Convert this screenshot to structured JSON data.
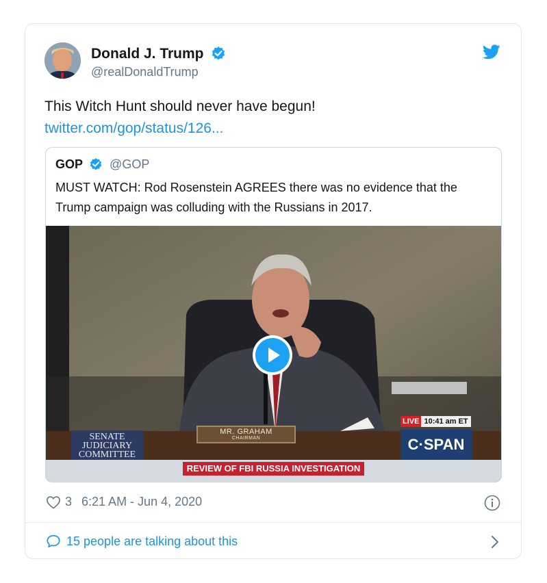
{
  "author": {
    "name": "Donald J. Trump",
    "handle": "@realDonaldTrump"
  },
  "tweet": {
    "text": "This Witch Hunt should never have begun!",
    "link": "twitter.com/gop/status/126..."
  },
  "quoted": {
    "name": "GOP",
    "handle": "@GOP",
    "text": "MUST WATCH: Rod Rosenstein AGREES there was no evidence that the Trump campaign was colluding with the Russians in 2017."
  },
  "video": {
    "senate_label": "SENATE JUDICIARY COMMITTEE",
    "nameplate_name": "MR. GRAHAM",
    "nameplate_title": "CHAIRMAN",
    "live_label": "LIVE",
    "live_time": "10:41 am ET",
    "network": "C·SPAN",
    "chyron": "REVIEW OF FBI RUSSIA INVESTIGATION"
  },
  "stats": {
    "likes": "3",
    "timestamp": "6:21 AM - Jun 4, 2020"
  },
  "footer": {
    "talking": "15 people are talking about this"
  },
  "colors": {
    "link": "#1b95e0",
    "verified": "#1da1f2",
    "secondary_text": "#657786"
  }
}
